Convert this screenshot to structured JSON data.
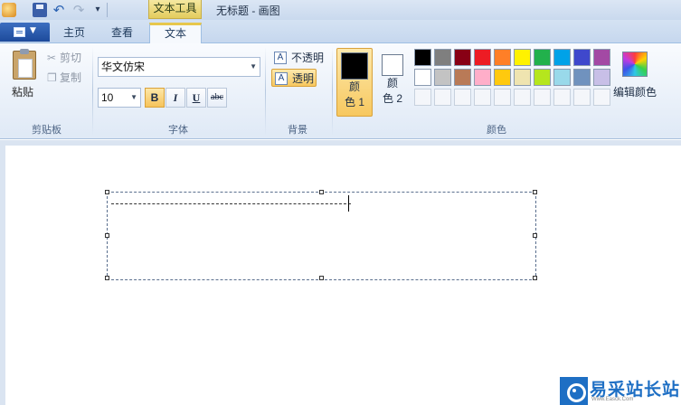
{
  "window": {
    "title": "无标题 - 画图",
    "context_tab": "文本工具"
  },
  "tabs": {
    "home": "主页",
    "view": "查看",
    "text": "文本"
  },
  "clipboard": {
    "paste": "粘贴",
    "cut": "剪切",
    "copy": "复制",
    "group": "剪贴板"
  },
  "font": {
    "family": "华文仿宋",
    "size": "10",
    "bold": "B",
    "italic": "I",
    "underline": "U",
    "strike": "abc",
    "group": "字体"
  },
  "background": {
    "opaque": "不透明",
    "transparent": "透明",
    "group": "背景"
  },
  "colors": {
    "color1_label": "颜\n色 1",
    "color1_line1": "颜",
    "color1_line2": "色 1",
    "color2_line1": "颜",
    "color2_line2": "色 2",
    "color1_value": "#000000",
    "color2_value": "#ffffff",
    "edit": "编辑颜色",
    "group": "颜色",
    "palette": [
      [
        "#000000",
        "#7f7f7f",
        "#880015",
        "#ed1c24",
        "#ff7f27",
        "#fff200",
        "#22b14c",
        "#00a2e8",
        "#3f48cc",
        "#a349a4"
      ],
      [
        "#ffffff",
        "#c3c3c3",
        "#b97a57",
        "#ffaec9",
        "#ffc90e",
        "#efe4b0",
        "#b5e61d",
        "#99d9ea",
        "#7092be",
        "#c8bfe7"
      ],
      [
        "",
        "",
        "",
        "",
        "",
        "",
        "",
        "",
        "",
        ""
      ]
    ]
  },
  "watermark": {
    "text": "易采站长站",
    "sub": "Www.Easck.Com"
  }
}
